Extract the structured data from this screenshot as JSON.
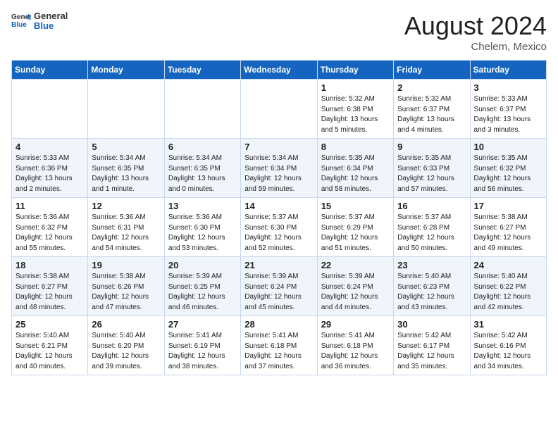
{
  "header": {
    "logo_general": "General",
    "logo_blue": "Blue",
    "month_title": "August 2024",
    "location": "Chelem, Mexico"
  },
  "weekdays": [
    "Sunday",
    "Monday",
    "Tuesday",
    "Wednesday",
    "Thursday",
    "Friday",
    "Saturday"
  ],
  "weeks": [
    [
      {
        "day": "",
        "info": ""
      },
      {
        "day": "",
        "info": ""
      },
      {
        "day": "",
        "info": ""
      },
      {
        "day": "",
        "info": ""
      },
      {
        "day": "1",
        "info": "Sunrise: 5:32 AM\nSunset: 6:38 PM\nDaylight: 13 hours\nand 5 minutes."
      },
      {
        "day": "2",
        "info": "Sunrise: 5:32 AM\nSunset: 6:37 PM\nDaylight: 13 hours\nand 4 minutes."
      },
      {
        "day": "3",
        "info": "Sunrise: 5:33 AM\nSunset: 6:37 PM\nDaylight: 13 hours\nand 3 minutes."
      }
    ],
    [
      {
        "day": "4",
        "info": "Sunrise: 5:33 AM\nSunset: 6:36 PM\nDaylight: 13 hours\nand 2 minutes."
      },
      {
        "day": "5",
        "info": "Sunrise: 5:34 AM\nSunset: 6:35 PM\nDaylight: 13 hours\nand 1 minute."
      },
      {
        "day": "6",
        "info": "Sunrise: 5:34 AM\nSunset: 6:35 PM\nDaylight: 13 hours\nand 0 minutes."
      },
      {
        "day": "7",
        "info": "Sunrise: 5:34 AM\nSunset: 6:34 PM\nDaylight: 12 hours\nand 59 minutes."
      },
      {
        "day": "8",
        "info": "Sunrise: 5:35 AM\nSunset: 6:34 PM\nDaylight: 12 hours\nand 58 minutes."
      },
      {
        "day": "9",
        "info": "Sunrise: 5:35 AM\nSunset: 6:33 PM\nDaylight: 12 hours\nand 57 minutes."
      },
      {
        "day": "10",
        "info": "Sunrise: 5:35 AM\nSunset: 6:32 PM\nDaylight: 12 hours\nand 56 minutes."
      }
    ],
    [
      {
        "day": "11",
        "info": "Sunrise: 5:36 AM\nSunset: 6:32 PM\nDaylight: 12 hours\nand 55 minutes."
      },
      {
        "day": "12",
        "info": "Sunrise: 5:36 AM\nSunset: 6:31 PM\nDaylight: 12 hours\nand 54 minutes."
      },
      {
        "day": "13",
        "info": "Sunrise: 5:36 AM\nSunset: 6:30 PM\nDaylight: 12 hours\nand 53 minutes."
      },
      {
        "day": "14",
        "info": "Sunrise: 5:37 AM\nSunset: 6:30 PM\nDaylight: 12 hours\nand 52 minutes."
      },
      {
        "day": "15",
        "info": "Sunrise: 5:37 AM\nSunset: 6:29 PM\nDaylight: 12 hours\nand 51 minutes."
      },
      {
        "day": "16",
        "info": "Sunrise: 5:37 AM\nSunset: 6:28 PM\nDaylight: 12 hours\nand 50 minutes."
      },
      {
        "day": "17",
        "info": "Sunrise: 5:38 AM\nSunset: 6:27 PM\nDaylight: 12 hours\nand 49 minutes."
      }
    ],
    [
      {
        "day": "18",
        "info": "Sunrise: 5:38 AM\nSunset: 6:27 PM\nDaylight: 12 hours\nand 48 minutes."
      },
      {
        "day": "19",
        "info": "Sunrise: 5:38 AM\nSunset: 6:26 PM\nDaylight: 12 hours\nand 47 minutes."
      },
      {
        "day": "20",
        "info": "Sunrise: 5:39 AM\nSunset: 6:25 PM\nDaylight: 12 hours\nand 46 minutes."
      },
      {
        "day": "21",
        "info": "Sunrise: 5:39 AM\nSunset: 6:24 PM\nDaylight: 12 hours\nand 45 minutes."
      },
      {
        "day": "22",
        "info": "Sunrise: 5:39 AM\nSunset: 6:24 PM\nDaylight: 12 hours\nand 44 minutes."
      },
      {
        "day": "23",
        "info": "Sunrise: 5:40 AM\nSunset: 6:23 PM\nDaylight: 12 hours\nand 43 minutes."
      },
      {
        "day": "24",
        "info": "Sunrise: 5:40 AM\nSunset: 6:22 PM\nDaylight: 12 hours\nand 42 minutes."
      }
    ],
    [
      {
        "day": "25",
        "info": "Sunrise: 5:40 AM\nSunset: 6:21 PM\nDaylight: 12 hours\nand 40 minutes."
      },
      {
        "day": "26",
        "info": "Sunrise: 5:40 AM\nSunset: 6:20 PM\nDaylight: 12 hours\nand 39 minutes."
      },
      {
        "day": "27",
        "info": "Sunrise: 5:41 AM\nSunset: 6:19 PM\nDaylight: 12 hours\nand 38 minutes."
      },
      {
        "day": "28",
        "info": "Sunrise: 5:41 AM\nSunset: 6:18 PM\nDaylight: 12 hours\nand 37 minutes."
      },
      {
        "day": "29",
        "info": "Sunrise: 5:41 AM\nSunset: 6:18 PM\nDaylight: 12 hours\nand 36 minutes."
      },
      {
        "day": "30",
        "info": "Sunrise: 5:42 AM\nSunset: 6:17 PM\nDaylight: 12 hours\nand 35 minutes."
      },
      {
        "day": "31",
        "info": "Sunrise: 5:42 AM\nSunset: 6:16 PM\nDaylight: 12 hours\nand 34 minutes."
      }
    ]
  ]
}
